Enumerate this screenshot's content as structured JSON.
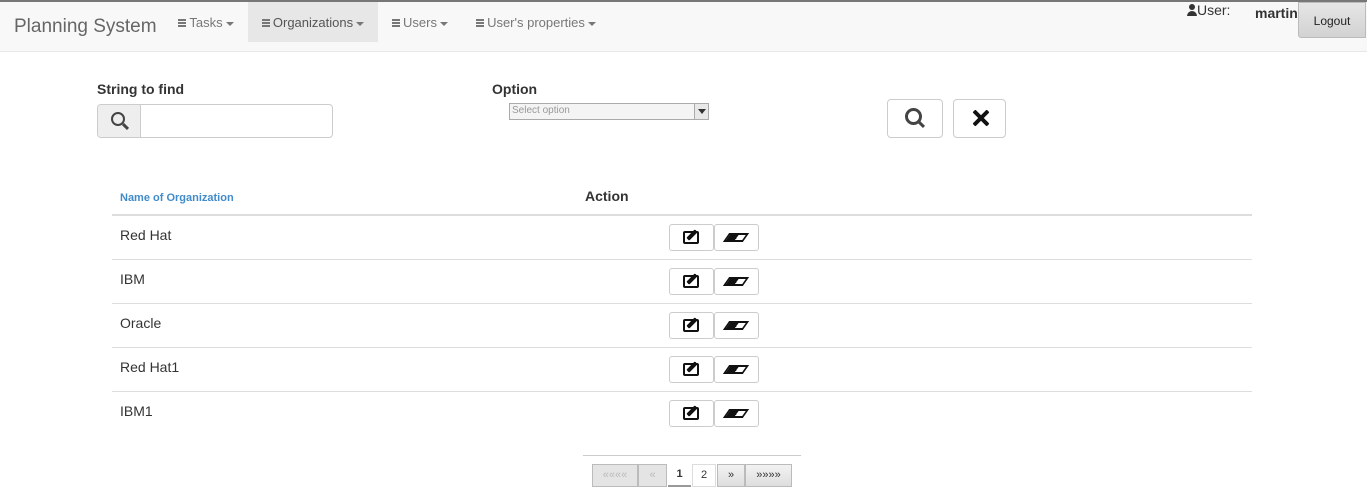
{
  "navbar": {
    "brand": "Planning System",
    "menus": [
      {
        "label": "Tasks",
        "active": false
      },
      {
        "label": "Organizations",
        "active": true
      },
      {
        "label": "Users",
        "active": false
      },
      {
        "label": "User's properties",
        "active": false
      }
    ],
    "user_label": "User:",
    "username": "martin",
    "logout_label": "Logout"
  },
  "filter": {
    "string_label": "String to find",
    "string_value": "",
    "option_label": "Option",
    "option_placeholder": "Select option",
    "search_icon": "search-icon",
    "clear_icon": "close-icon"
  },
  "table": {
    "col_name": "Name of Organization",
    "col_action": "Action",
    "rows": [
      {
        "name": "Red Hat"
      },
      {
        "name": "IBM"
      },
      {
        "name": "Oracle"
      },
      {
        "name": "Red Hat1"
      },
      {
        "name": "IBM1"
      }
    ],
    "edit_icon": "edit-icon",
    "delete_icon": "eraser-icon"
  },
  "pagination": {
    "first": "««««",
    "prev": "«",
    "pages": [
      "1",
      "2"
    ],
    "current_page": "1",
    "next": "»",
    "last": "»»»»"
  },
  "colors": {
    "link": "#428bca",
    "navbar_bg": "#f8f8f8"
  }
}
